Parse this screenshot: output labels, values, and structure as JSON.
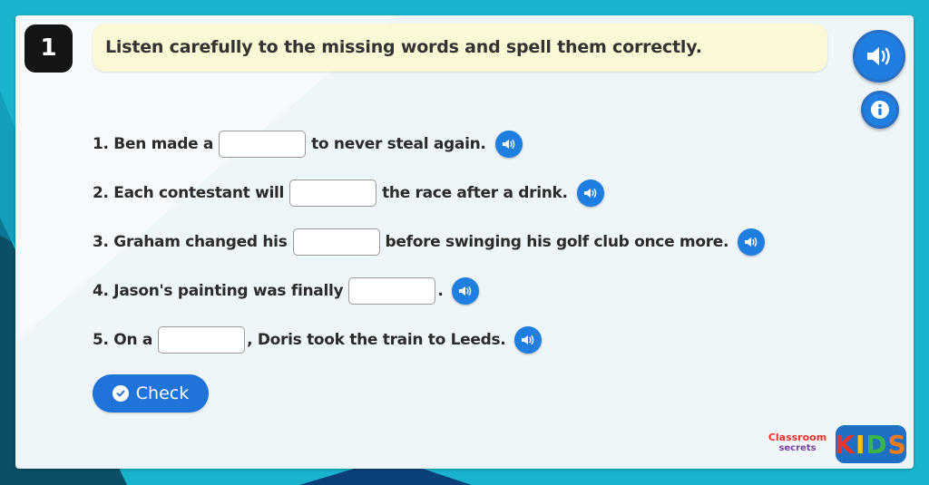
{
  "question": {
    "number": "1",
    "instruction": "Listen carefully to the missing words and spell them correctly."
  },
  "icons": {
    "audio": "speaker-icon",
    "info": "info-icon",
    "check": "check-circle-icon"
  },
  "sentences": [
    {
      "before": "1. Ben made a",
      "after": "to never steal again.",
      "value": ""
    },
    {
      "before": "2. Each contestant will",
      "after": "the race after a drink.",
      "value": ""
    },
    {
      "before": "3. Graham changed his",
      "after": "before swinging his golf club once more.",
      "value": ""
    },
    {
      "before": "4. Jason's painting was finally",
      "after": ".",
      "value": ""
    },
    {
      "before": "5. On a",
      "after": ", Doris took the train to Leeds.",
      "value": ""
    }
  ],
  "check_button": {
    "label": "Check"
  },
  "logos": {
    "classroom_line1": "Classroom",
    "classroom_line2": "secrets",
    "kids_letters": [
      "K",
      "I",
      "D",
      "S"
    ],
    "kids_colors": [
      "#e8332a",
      "#f2c21b",
      "#3bb54a",
      "#ef7d1a"
    ]
  },
  "colors": {
    "accent_blue": "#1f7fe0",
    "instruction_bg": "#fbf8d6",
    "page_bg": "#19b3cf"
  }
}
